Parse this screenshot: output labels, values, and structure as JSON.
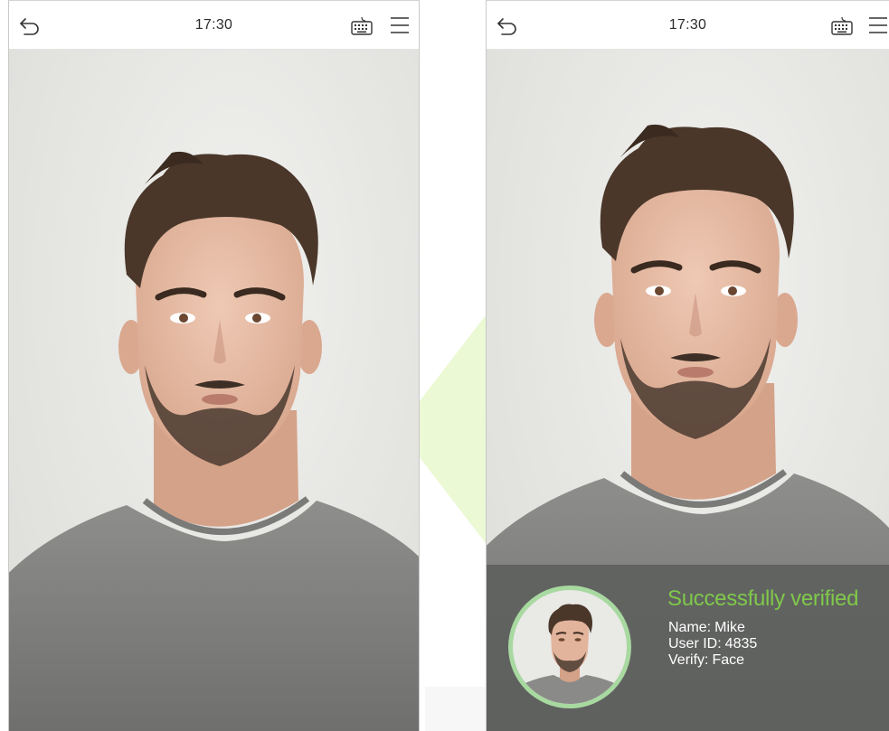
{
  "screens": [
    {
      "id": "left",
      "status_bar": {
        "time": "17:30",
        "back_icon": "back-arrow-icon",
        "keyboard_icon": "keyboard-icon",
        "menu_icon": "hamburger-menu-icon"
      }
    },
    {
      "id": "right",
      "status_bar": {
        "time": "17:30",
        "back_icon": "back-arrow-icon",
        "keyboard_icon": "keyboard-icon",
        "menu_icon": "hamburger-menu-icon"
      },
      "verification": {
        "title": "Successfully verified",
        "fields": [
          {
            "label": "Name:",
            "value": "Mike"
          },
          {
            "label": "User ID:",
            "value": "4835"
          },
          {
            "label": "Verify:",
            "value": "Face"
          }
        ]
      }
    }
  ],
  "colors": {
    "success_green": "#7fc94a",
    "avatar_ring": "#a8d9a0",
    "arrow_watermark": "#e6f7cf",
    "panel_overlay": "#5c5e5c"
  }
}
